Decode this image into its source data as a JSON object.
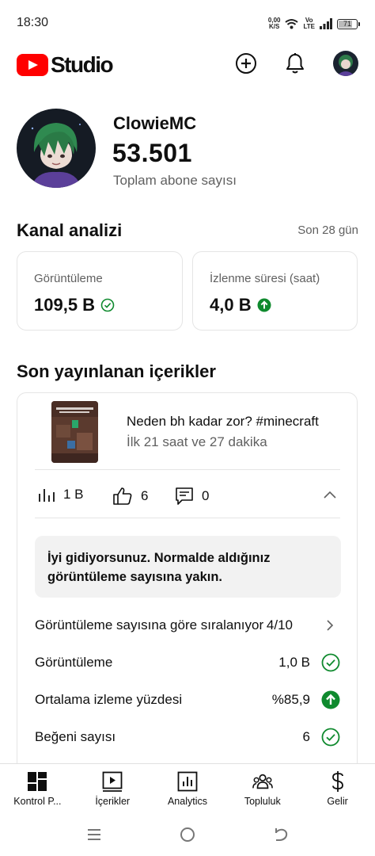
{
  "status_bar": {
    "time": "18:30",
    "net_speed_value": "0,00",
    "net_speed_unit": "K/S",
    "network_top": "Vo",
    "network_bottom": "LTE",
    "battery": "71"
  },
  "header": {
    "app_name": "Studio",
    "icons": [
      "create-icon",
      "bell-icon",
      "avatar"
    ]
  },
  "channel": {
    "name": "ClowieMC",
    "subscribers": "53.501",
    "subscribers_label": "Toplam abone sayısı"
  },
  "analytics": {
    "title": "Kanal analizi",
    "period": "Son 28 gün",
    "cards": [
      {
        "label": "Görüntüleme",
        "value": "109,5 B",
        "status": "check"
      },
      {
        "label": "İzlenme süresi (saat)",
        "value": "4,0 B",
        "status": "up"
      }
    ],
    "colors": {
      "positive": "#0f8a2e"
    }
  },
  "recent": {
    "title": "Son yayınlanan içerikler",
    "video": {
      "title": "Neden bh kadar zor? #minecraft",
      "subtitle": "İlk 21 saat ve 27 dakika",
      "views": "1 B",
      "likes": "6",
      "comments": "0"
    },
    "insight": "İyi gidiyorsunuz. Normalde aldığınız görüntüleme sayısına yakın.",
    "rows": [
      {
        "label": "Görüntüleme sayısına göre sıralanıyor",
        "value": "4/10",
        "icon": "chevron-right-icon"
      },
      {
        "label": "Görüntüleme",
        "value": "1,0 B",
        "icon": "check-circle-icon"
      },
      {
        "label": "Ortalama izleme yüzdesi",
        "value": "%85,9",
        "icon": "arrow-up-circle-icon"
      },
      {
        "label": "Beğeni sayısı",
        "value": "6",
        "icon": "check-circle-icon"
      }
    ]
  },
  "bottom_nav": [
    {
      "label": "Kontrol P...",
      "icon": "dashboard-icon"
    },
    {
      "label": "İçerikler",
      "icon": "content-icon"
    },
    {
      "label": "Analytics",
      "icon": "analytics-icon"
    },
    {
      "label": "Topluluk",
      "icon": "community-icon"
    },
    {
      "label": "Gelir",
      "icon": "dollar-icon"
    }
  ]
}
